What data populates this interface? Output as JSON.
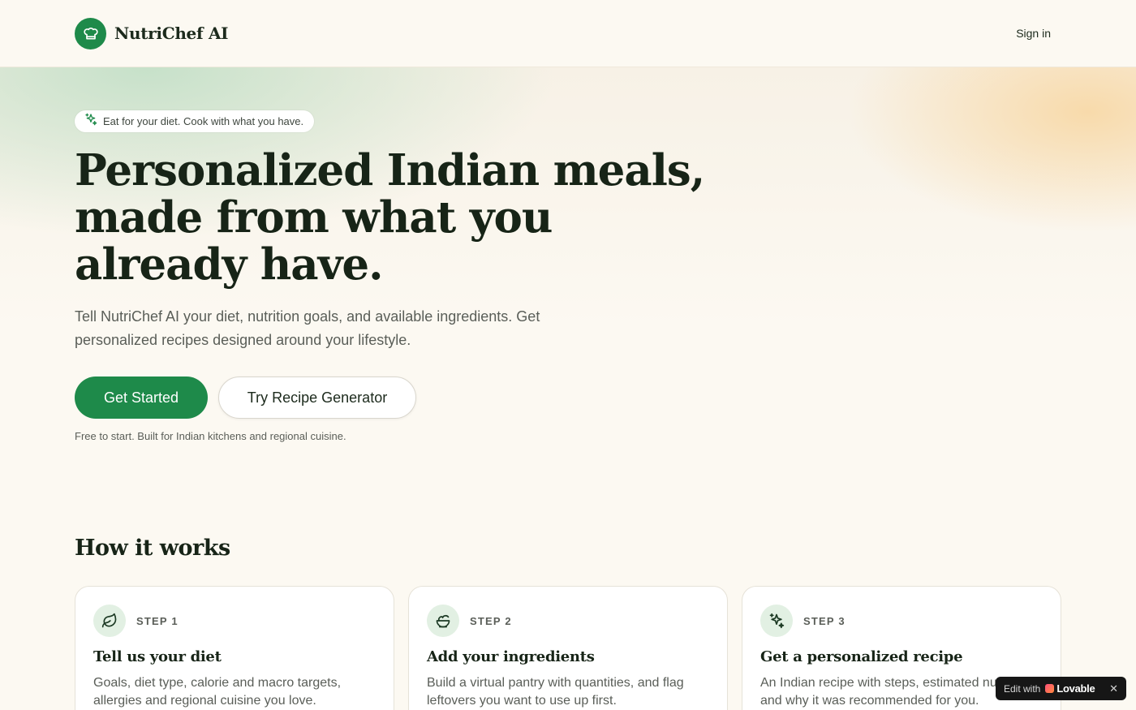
{
  "header": {
    "brand_name": "NutriChef AI",
    "signin_label": "Sign in"
  },
  "hero": {
    "badge_text": "Eat for your diet. Cook with what you have.",
    "title": "Personalized Indian meals, made from what you already have.",
    "subtitle": "Tell NutriChef AI your diet, nutrition goals, and available ingredients. Get personalized recipes designed around your lifestyle.",
    "primary_cta": "Get Started",
    "secondary_cta": "Try Recipe Generator",
    "note": "Free to start. Built for Indian kitchens and regional cuisine."
  },
  "how_it_works": {
    "title": "How it works",
    "steps": [
      {
        "step": "STEP 1",
        "title": "Tell us your diet",
        "description": "Goals, diet type, calorie and macro targets, allergies and regional cuisine you love.",
        "icon": "leaf-icon"
      },
      {
        "step": "STEP 2",
        "title": "Add your ingredients",
        "description": "Build a virtual pantry with quantities, and flag leftovers you want to use up first.",
        "icon": "salad-icon"
      },
      {
        "step": "STEP 3",
        "title": "Get a personalized recipe",
        "description": "An Indian recipe with steps, estimated nutrition and why it was recommended for you.",
        "icon": "sparkles-icon"
      }
    ]
  },
  "lovable_badge": {
    "edit_label": "Edit with",
    "brand": "Lovable",
    "close_symbol": "✕"
  },
  "colors": {
    "primary": "#1e8a4a",
    "background": "#fcf9f2",
    "heading": "#172417",
    "icon_bg": "#e2f0e3"
  }
}
